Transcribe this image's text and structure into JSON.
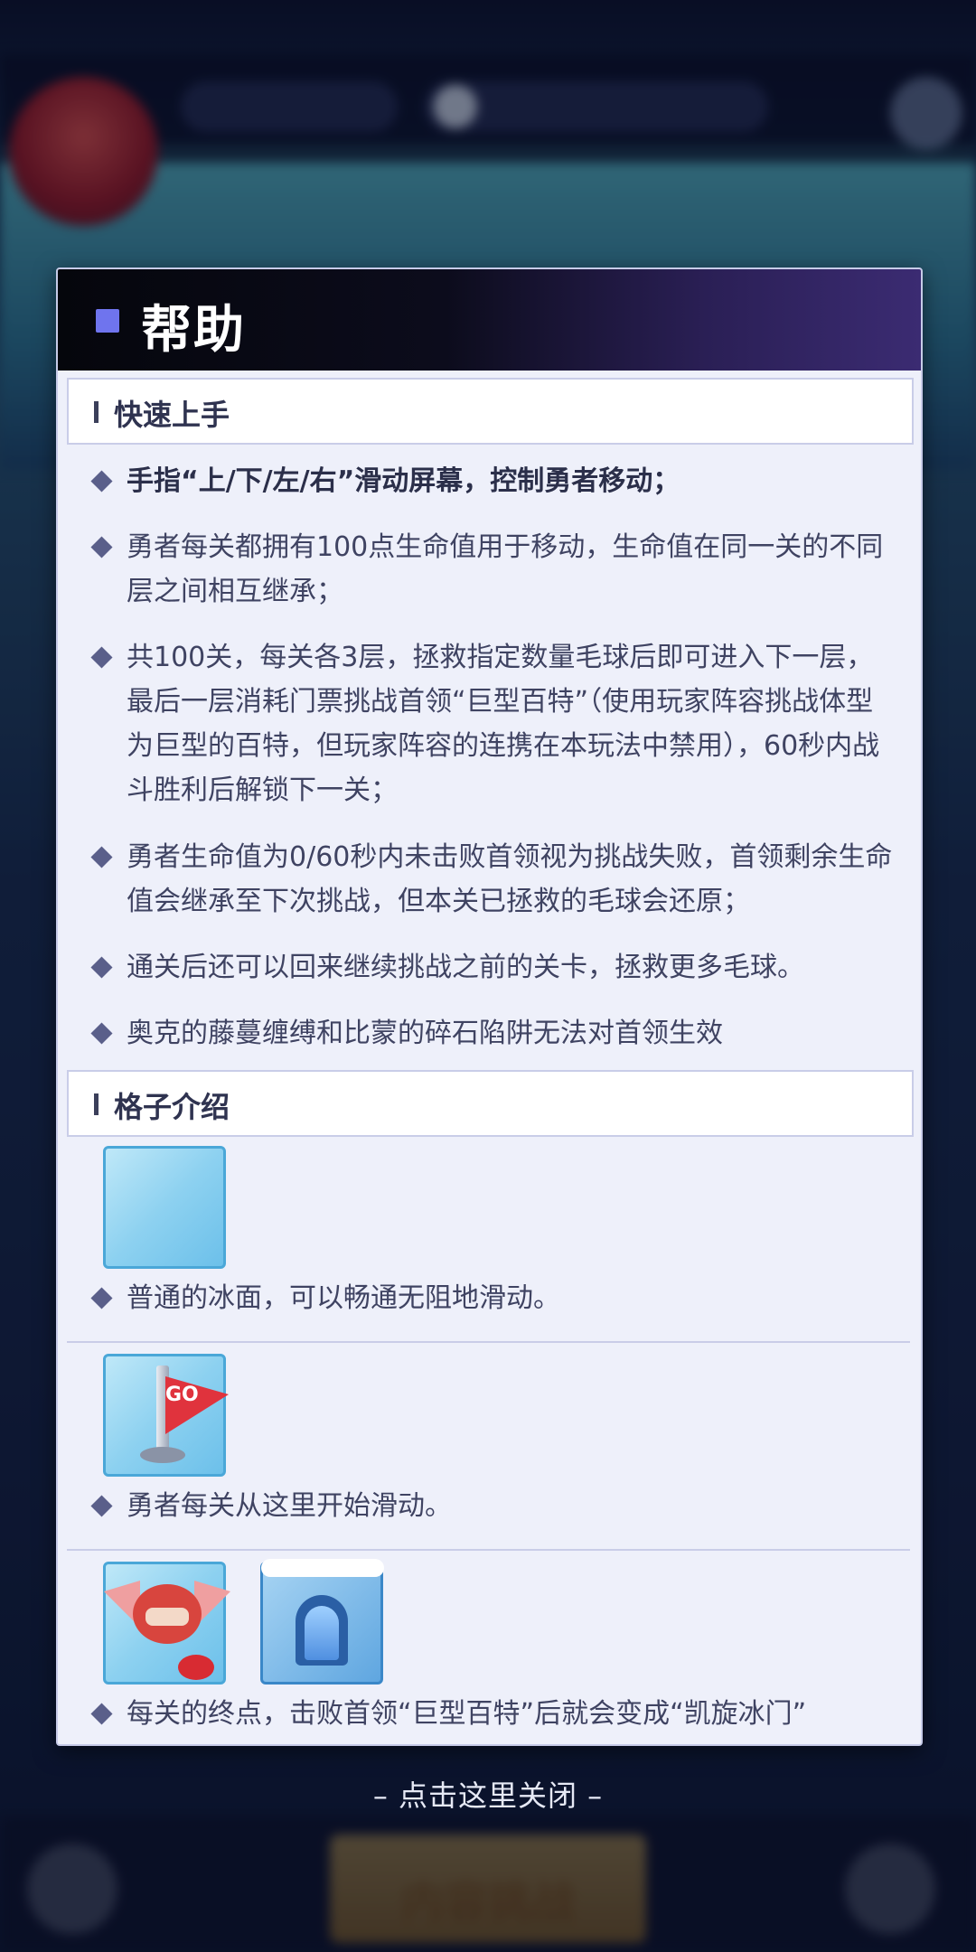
{
  "background": {
    "bottom_button_label": "内容挑战"
  },
  "dialog": {
    "title": "帮助",
    "accent_color": "#6f74ee"
  },
  "sections": {
    "quick_start": {
      "title": "快速上手",
      "items": [
        "手指“上/下/左/右”滑动屏幕，控制勇者移动；",
        "勇者每关都拥有100点生命值用于移动，生命值在同一关的不同层之间相互继承；",
        "共100关，每关各3层，拯救指定数量毛球后即可进入下一层，最后一层消耗门票挑战首领“巨型百特”（使用玩家阵容挑战体型为巨型的百特，但玩家阵容的连携在本玩法中禁用），60秒内战斗胜利后解锁下一关；",
        "勇者生命值为0/60秒内未击败首领视为挑战失败，首领剩余生命值会继承至下次挑战，但本关已拯救的毛球会还原；",
        "通关后还可以回来继续挑战之前的关卡，拯救更多毛球。",
        "奥克的藤蔓缠缚和比蒙的碎石陷阱无法对首领生效"
      ]
    },
    "grid_intro": {
      "title": "格子介绍",
      "tiles": [
        {
          "icons": [
            "ice-tile-icon"
          ],
          "desc": "普通的冰面，可以畅通无阻地滑动。"
        },
        {
          "icons": [
            "start-flag-icon"
          ],
          "flag_text": "GO",
          "desc": "勇者每关从这里开始滑动。"
        },
        {
          "icons": [
            "boss-baite-icon",
            "ice-gate-icon"
          ],
          "desc": "每关的终点，击败首领“巨型百特”后就会变成“凯旋冰门”"
        }
      ]
    }
  },
  "footer": {
    "close_hint": "– 点击这里关闭 –"
  }
}
